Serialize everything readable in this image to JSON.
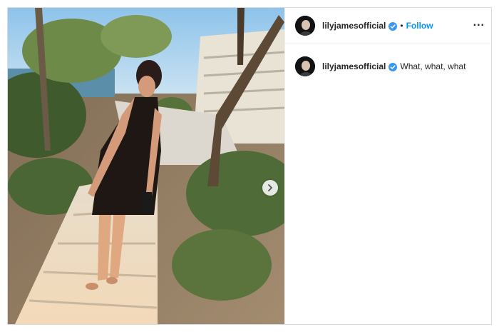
{
  "post": {
    "header": {
      "username": "lilyjamesofficial",
      "separator": "•",
      "follow_label": "Follow",
      "more_label": "..."
    },
    "caption": {
      "username": "lilyjamesofficial",
      "text": "What, what, what"
    },
    "media": {
      "icon": "chevron-right-icon"
    }
  },
  "colors": {
    "follow": "#0095f6",
    "verified": "#3897f0",
    "border": "#dbdbdb"
  }
}
